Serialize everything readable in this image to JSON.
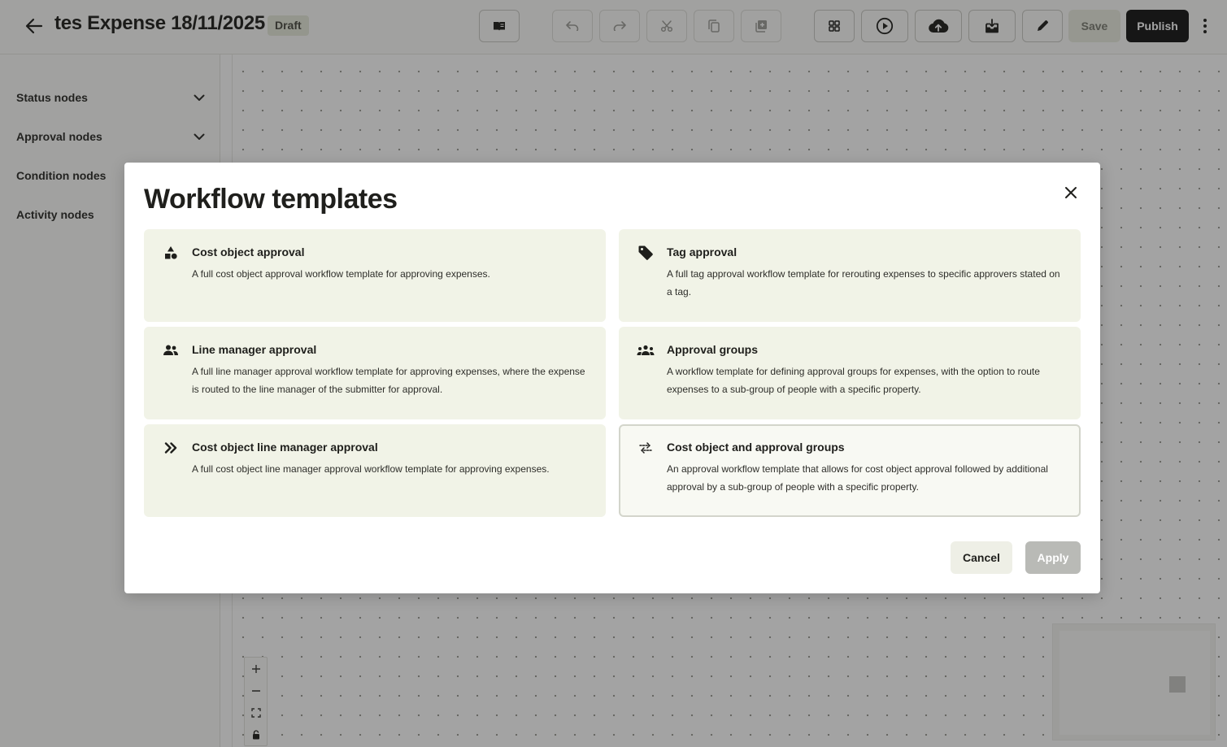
{
  "header": {
    "title": "tes Expense 18/11/2025",
    "status_badge": "Draft",
    "save_label": "Save",
    "publish_label": "Publish"
  },
  "sidebar": {
    "items": [
      {
        "label": "Status nodes",
        "expandable": true
      },
      {
        "label": "Approval nodes",
        "expandable": true
      },
      {
        "label": "Condition nodes",
        "expandable": false
      },
      {
        "label": "Activity nodes",
        "expandable": false
      }
    ]
  },
  "modal": {
    "title": "Workflow templates",
    "templates": [
      {
        "title": "Cost object approval",
        "description": "A full cost object approval workflow template for approving expenses.",
        "icon": "shapes-icon",
        "selected": false
      },
      {
        "title": "Tag approval",
        "description": "A full tag approval workflow template for rerouting expenses to specific approvers stated on a tag.",
        "icon": "tag-icon",
        "selected": false
      },
      {
        "title": "Line manager approval",
        "description": "A full line manager approval workflow template for approving expenses, where the expense is routed to the line manager of the submitter for approval.",
        "icon": "people-icon",
        "selected": false
      },
      {
        "title": "Approval groups",
        "description": "A workflow template for defining approval groups for expenses, with the option to route expenses to a sub-group of people with a specific property.",
        "icon": "group-icon",
        "selected": false
      },
      {
        "title": "Cost object line manager approval",
        "description": "A full cost object line manager approval workflow template for approving expenses.",
        "icon": "double-chevron-right-icon",
        "selected": false
      },
      {
        "title": "Cost object and approval groups",
        "description": "An approval workflow template that allows for cost object approval followed by additional approval by a sub-group of people with a specific property.",
        "icon": "swap-arrows-icon",
        "selected": true
      }
    ],
    "cancel_label": "Cancel",
    "apply_label": "Apply"
  },
  "colors": {
    "card_background": "#f1f3e7",
    "primary_button": "#141414",
    "disabled_button": "#b9bab6"
  }
}
